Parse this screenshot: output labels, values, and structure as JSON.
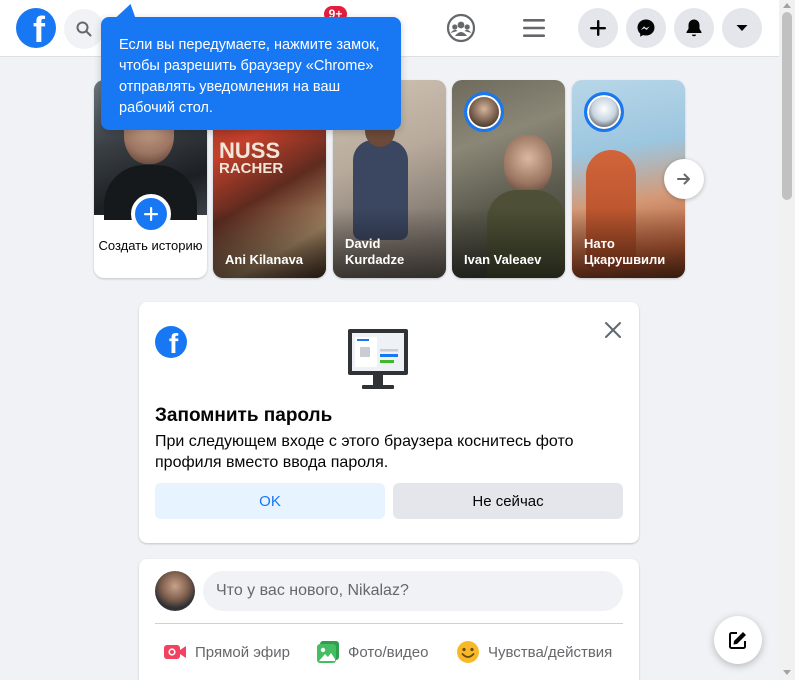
{
  "header": {
    "notification_badge": "9+"
  },
  "tooltip": {
    "text": "Если вы передумаете, нажмите замок, чтобы разрешить браузеру «Chrome» отправлять уведомления на ваш рабочий стол."
  },
  "stories": {
    "create_label": "Создать историю",
    "items": [
      {
        "name": "Ani Kilanava"
      },
      {
        "name": "David Kurdadze"
      },
      {
        "name": "Ivan Valeaev"
      },
      {
        "name": "Нато Цкарушвили"
      }
    ]
  },
  "save_password": {
    "title": "Запомнить пароль",
    "description": "При следующем входе с этого браузера коснитесь фото профиля вместо ввода пароля.",
    "ok_label": "OK",
    "later_label": "Не сейчас"
  },
  "composer": {
    "placeholder": "Что у вас нового, Nikalaz?",
    "actions": [
      {
        "label": "Прямой эфир",
        "icon": "live-video-icon",
        "color": "#f3425f"
      },
      {
        "label": "Фото/видео",
        "icon": "photo-icon",
        "color": "#45bd62"
      },
      {
        "label": "Чувства/действия",
        "icon": "feeling-icon",
        "color": "#f7b928"
      }
    ]
  },
  "colors": {
    "brand": "#1877f2",
    "badge": "#e41e3f"
  }
}
